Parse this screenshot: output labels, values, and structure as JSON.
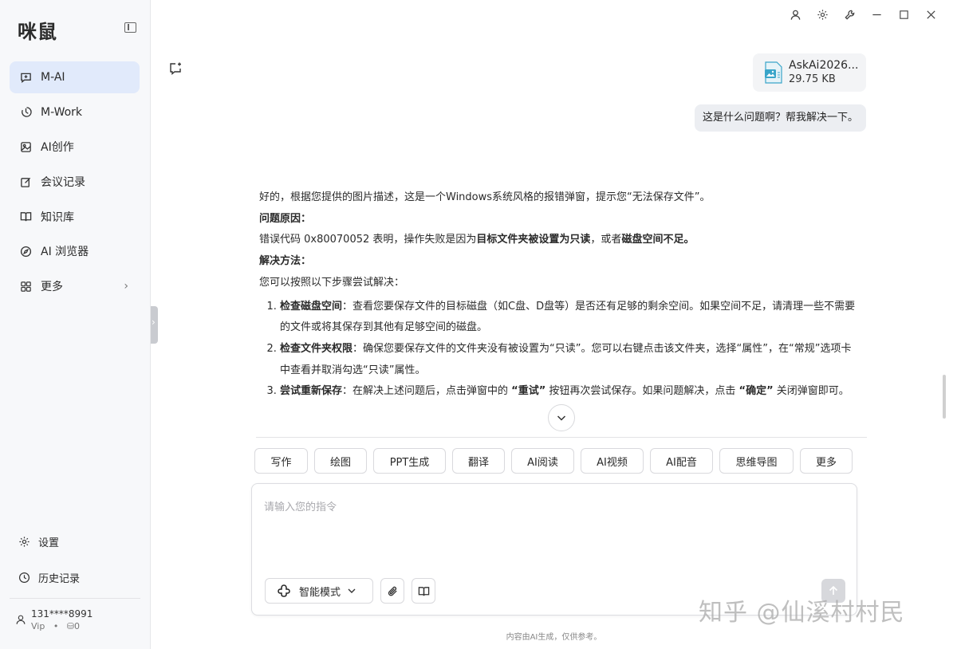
{
  "app": {
    "logo": "咪鼠"
  },
  "sidebar": {
    "items": [
      {
        "label": "M-AI",
        "icon": "chat-icon",
        "active": true
      },
      {
        "label": "M-Work",
        "icon": "work-icon",
        "active": false
      },
      {
        "label": "AI创作",
        "icon": "image-icon",
        "active": false
      },
      {
        "label": "会议记录",
        "icon": "edit-icon",
        "active": false
      },
      {
        "label": "知识库",
        "icon": "book-icon",
        "active": false
      },
      {
        "label": "AI 浏览器",
        "icon": "compass-icon",
        "active": false
      },
      {
        "label": "更多",
        "icon": "grid-icon",
        "active": false
      }
    ],
    "bottom": [
      {
        "label": "设置",
        "icon": "gear-icon"
      },
      {
        "label": "历史记录",
        "icon": "history-icon"
      }
    ],
    "user": {
      "name": "131****8991",
      "tier": "Vip",
      "dot": "•",
      "points": "⛁0"
    }
  },
  "chat": {
    "attachment": {
      "name": "AskAi2026...",
      "size": "29.75 KB"
    },
    "user_message": "这是什么问题啊？帮我解决一下。",
    "answer": {
      "intro": "好的，根据您提供的图片描述，这是一个Windows系统风格的报错弹窗，提示您“无法保存文件”。",
      "cause_heading": "问题原因：",
      "cause_prefix": "错误代码 0x80070052 表明，操作失败是因为",
      "cause_bold1": "目标文件夹被设置为只读",
      "cause_mid": "，或者",
      "cause_bold2": "磁盘空间不足。",
      "solution_heading": "解决方法：",
      "solution_intro": "您可以按照以下步骤尝试解决：",
      "steps": [
        {
          "title": "检查磁盘空间",
          "sep": "：",
          "text": "查看您要保存文件的目标磁盘（如C盘、D盘等）是否还有足够的剩余空间。如果空间不足，请清理一些不需要的文件或将其保存到其他有足够空间的磁盘。"
        },
        {
          "title": "检查文件夹权限",
          "sep": "：",
          "text": "确保您要保存文件的文件夹没有被设置为“只读”。您可以右键点击该文件夹，选择“属性”，在“常规”选项卡中查看并取消勾选“只读”属性。"
        },
        {
          "title": "尝试重新保存",
          "sep": "：",
          "text_a": "在解决上述问题后，点击弹窗中的 ",
          "bold_a": "“重试”",
          "text_b": " 按钮再次尝试保存。如果问题解决，点击 ",
          "bold_b": "“确定”",
          "text_c": " 关闭弹窗即可。"
        }
      ]
    }
  },
  "tools": [
    "写作",
    "绘图",
    "PPT生成",
    "翻译",
    "AI阅读",
    "AI视频",
    "AI配音",
    "思维导图",
    "更多"
  ],
  "input": {
    "placeholder": "请输入您的指令",
    "mode_label": "智能模式"
  },
  "footer": {
    "disclaimer": "内容由AI生成，仅供参考。",
    "watermark": "知乎 @仙溪村村民"
  }
}
